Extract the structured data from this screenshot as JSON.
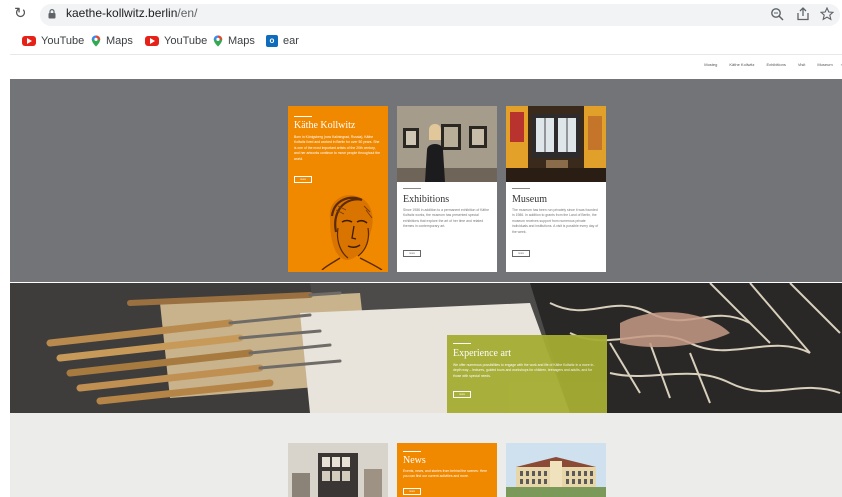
{
  "browser": {
    "url_domain": "kaethe-kollwitz.berlin",
    "url_path": "/en/",
    "bookmarks": [
      {
        "label": "YouTube",
        "icon": "youtube-icon"
      },
      {
        "label": "Maps",
        "icon": "maps-pin-icon"
      },
      {
        "label": "YouTube",
        "icon": "youtube-icon"
      },
      {
        "label": "Maps",
        "icon": "maps-pin-icon"
      },
      {
        "label": "ear",
        "icon": "outlook-icon"
      }
    ],
    "icons": [
      "reload-icon",
      "lock-icon",
      "zoom-icon",
      "share-icon",
      "star-icon"
    ]
  },
  "site": {
    "nav": [
      "Mosteg",
      "Käthe Kollwitz",
      "Exhibitions",
      "Visit",
      "Museum"
    ],
    "tiles": {
      "kollwitz": {
        "title": "Käthe Kollwitz",
        "text": "Born in Königsberg (now Kaliningrad, Russia), Käthe Kollwitz lived and worked in Berlin for over 50 years. She is one of the most important artists of the 20th century, and her artworks continue to move people throughout the world.",
        "button": "more"
      },
      "exhibitions": {
        "title": "Exhibitions",
        "text": "Since 1986 in addition to a permanent exhibition of Käthe Kollwitz works, the museum has presented special exhibitions that explore the art of her time and related themes in contemporary art.",
        "button": "more"
      },
      "museum": {
        "title": "Museum",
        "text": "The museum has been run privately since it was founded in 1986. In addition to grants from the Land of Berlin, the museum receives support from numerous private individuals and institutions. A visit is possible every day of the week.",
        "button": "more"
      },
      "experience": {
        "title": "Experience art",
        "text": "We offer numerous possibilities to engage with the work and life of Käthe Kollwitz in a more in-depth way – lectures, guided tours and workshops for children, teenagers and adults, and for those with special needs.",
        "button": "more"
      },
      "news": {
        "title": "News",
        "text": "Events, news, and stories from behind the scenes: Here you can find our current activities and more.",
        "button": "more"
      }
    }
  },
  "colors": {
    "orange": "#f08800",
    "grey_band": "#727478",
    "olive": "#a5ad32",
    "bottom_band": "#ececea"
  }
}
